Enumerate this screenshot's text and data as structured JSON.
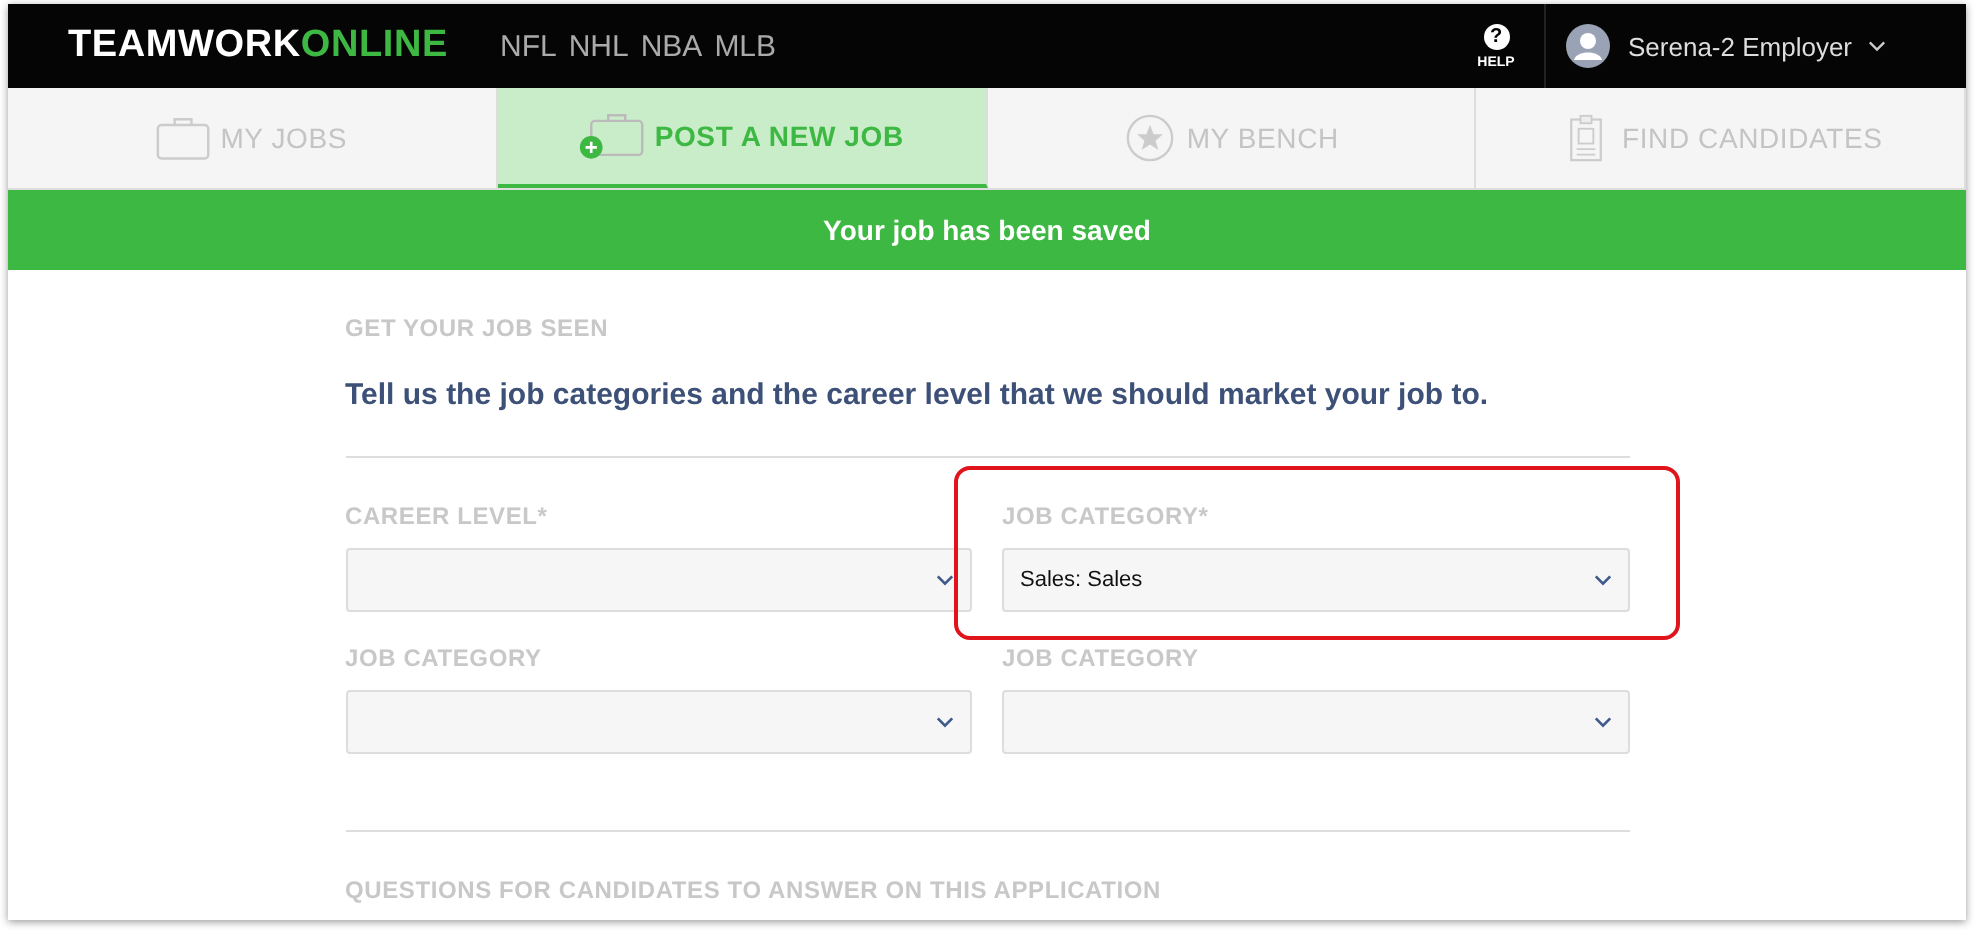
{
  "header": {
    "logo": {
      "first": "TEAMWORK",
      "second": "ONLINE"
    },
    "leagues": [
      "NFL",
      "NHL",
      "NBA",
      "MLB"
    ],
    "help": {
      "icon": "?",
      "label": "HELP"
    },
    "user": {
      "name": "Serena-2 Employer"
    }
  },
  "tabs": [
    {
      "label": "MY JOBS",
      "kind": "briefcase",
      "selected": false
    },
    {
      "label": "POST A NEW JOB",
      "kind": "add",
      "selected": true
    },
    {
      "label": "MY BENCH",
      "kind": "bench",
      "selected": false
    },
    {
      "label": "FIND CANDIDATES",
      "kind": "candidates",
      "selected": false
    }
  ],
  "banner": "Your job has been saved",
  "section": {
    "label": "GET YOUR JOB SEEN",
    "heading": "Tell us the job categories and the career level that we should market your job to."
  },
  "fields": [
    {
      "label": "CAREER LEVEL*",
      "highlighted": false
    },
    {
      "label": "JOB CATEGORY*",
      "value": "Sales: Sales",
      "highlighted": true
    },
    {
      "label": "JOB CATEGORY",
      "highlighted": false
    },
    {
      "label": "JOB CATEGORY",
      "highlighted": false
    }
  ],
  "next_section": {
    "label": "QUESTIONS FOR CANDIDATES TO ANSWER ON THIS APPLICATION"
  }
}
